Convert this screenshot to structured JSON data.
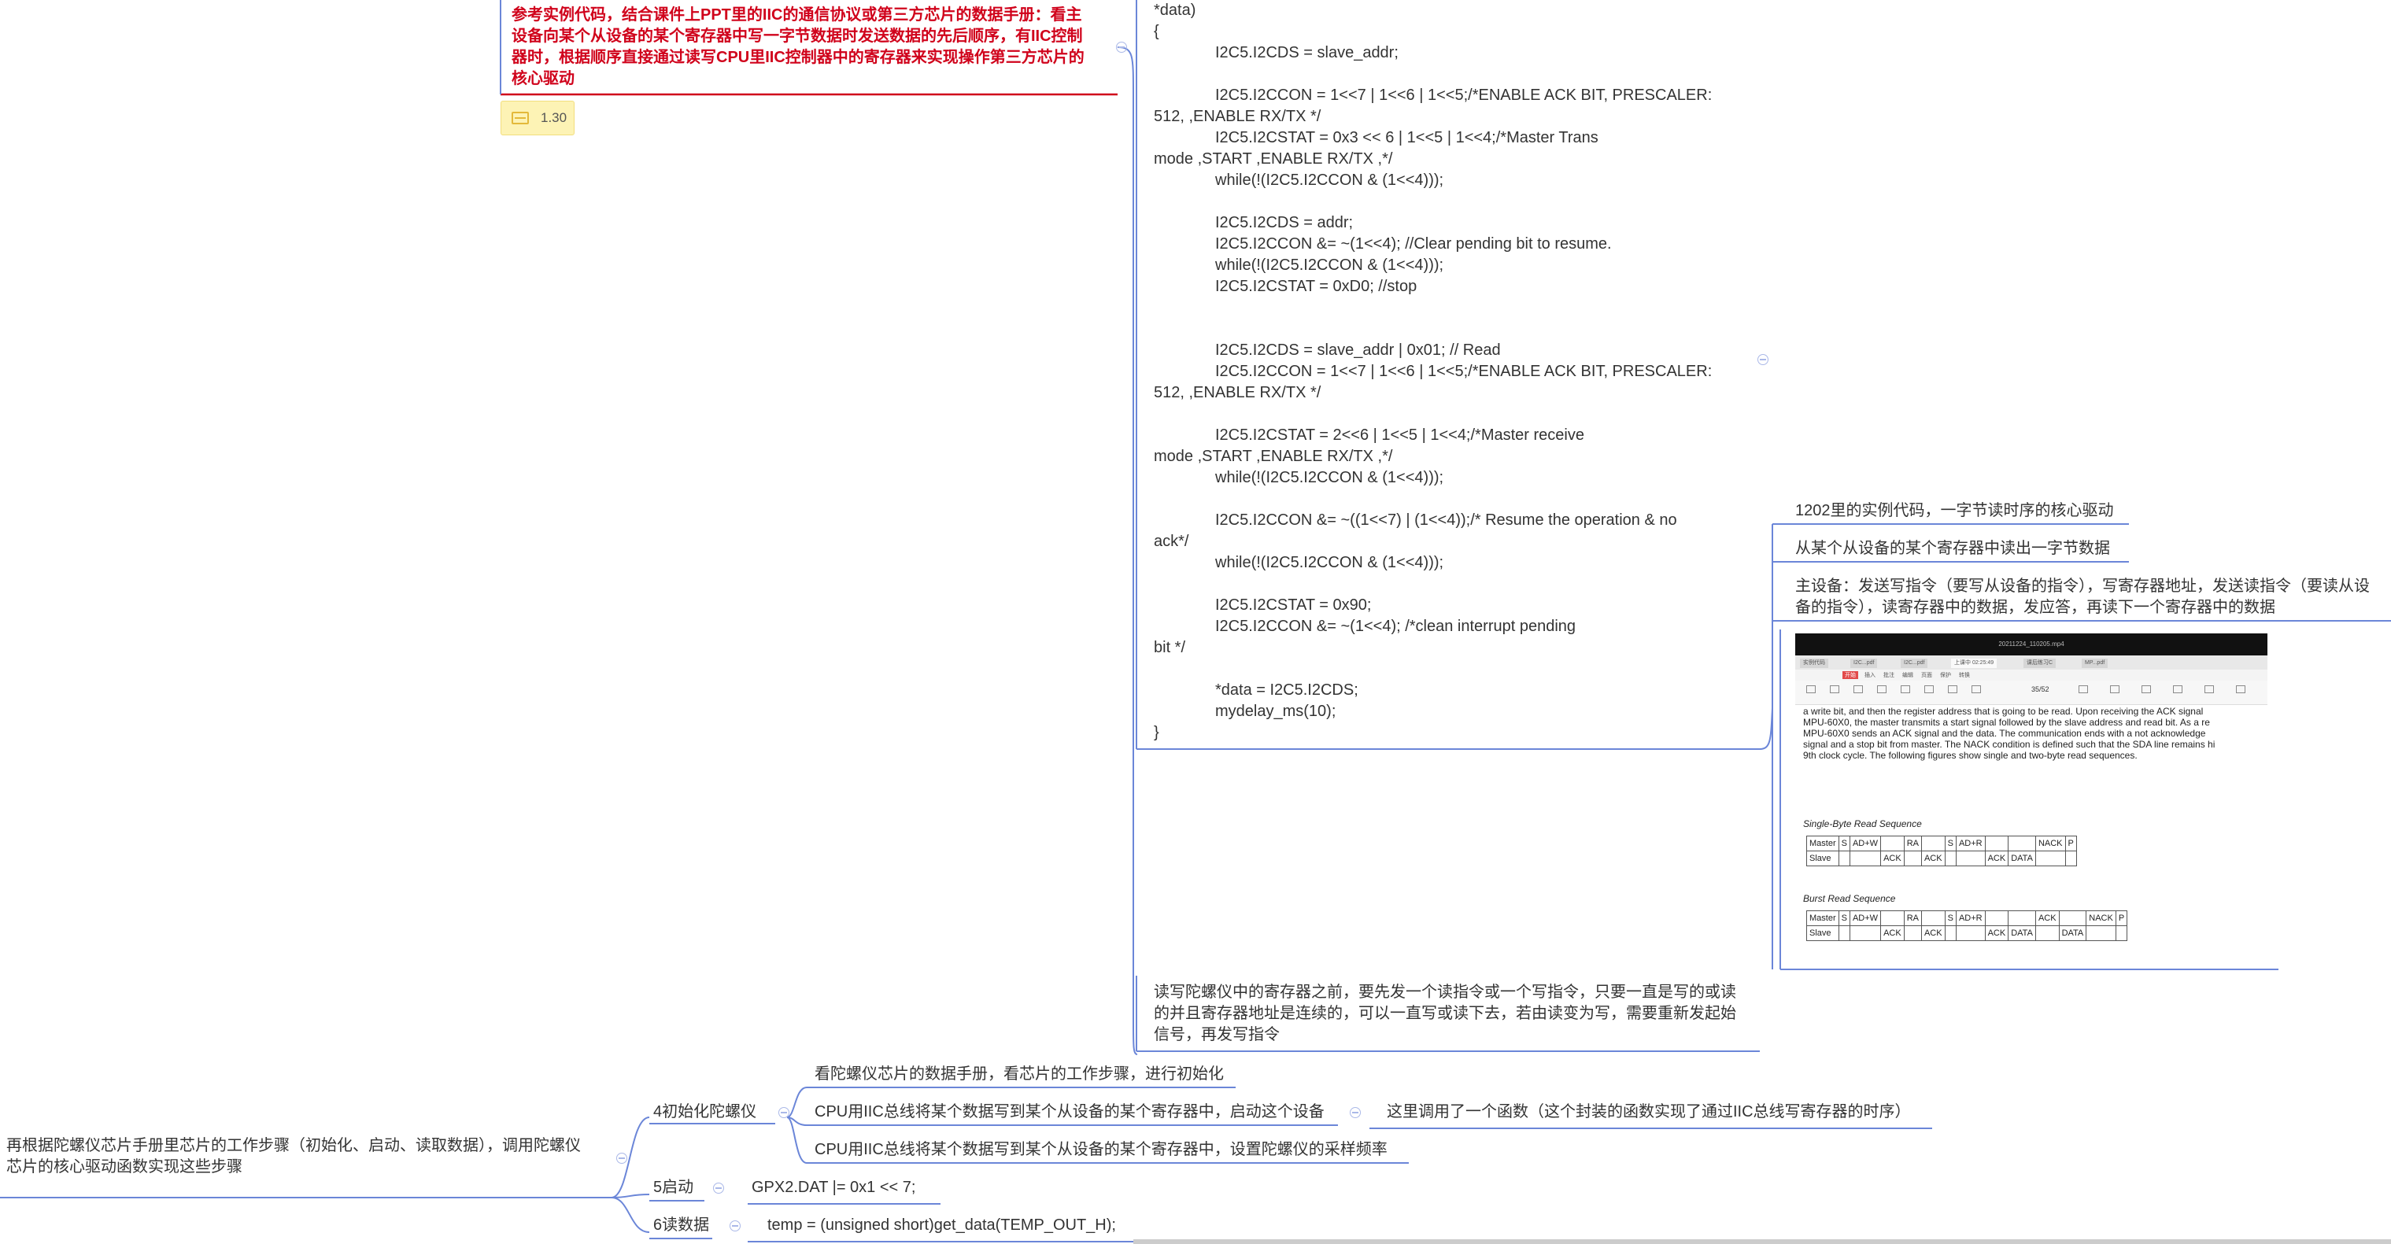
{
  "left_topic": {
    "red_note": [
      "参考实例代码，结合课件上PPT里的IIC的通信协议或第三方芯片的数据手册：看主",
      "设备向某个从设备的某个寄存器中写一字节数据时发送数据的先后顺序，有IIC控制",
      "器时，根据顺序直接通过读写CPU里IIC控制器中的寄存器来实现操作第三方芯片的",
      "核心驱动"
    ],
    "tag_value": "1.30"
  },
  "code": [
    {
      "t": "*data)",
      "i": false
    },
    {
      "t": "{",
      "i": false
    },
    {
      "t": "I2C5.I2CDS = slave_addr;",
      "i": true
    },
    {
      "t": "",
      "i": false
    },
    {
      "t": "I2C5.I2CCON = 1<<7 | 1<<6 | 1<<5;/*ENABLE ACK BIT, PRESCALER:",
      "i": true
    },
    {
      "t": "512, ,ENABLE RX/TX */",
      "i": false
    },
    {
      "t": "I2C5.I2CSTAT = 0x3 << 6 | 1<<5 | 1<<4;/*Master Trans",
      "i": true
    },
    {
      "t": "mode ,START ,ENABLE RX/TX ,*/",
      "i": false
    },
    {
      "t": "while(!(I2C5.I2CCON & (1<<4)));",
      "i": true
    },
    {
      "t": "",
      "i": false
    },
    {
      "t": "I2C5.I2CDS = addr;",
      "i": true
    },
    {
      "t": "I2C5.I2CCON &= ~(1<<4);          //Clear pending bit to resume.",
      "i": true
    },
    {
      "t": "while(!(I2C5.I2CCON & (1<<4)));",
      "i": true
    },
    {
      "t": "I2C5.I2CSTAT = 0xD0; //stop",
      "i": true
    },
    {
      "t": "",
      "i": false
    },
    {
      "t": "",
      "i": false
    },
    {
      "t": "I2C5.I2CDS = slave_addr | 0x01; // Read",
      "i": true
    },
    {
      "t": "I2C5.I2CCON = 1<<7 | 1<<6 | 1<<5;/*ENABLE ACK BIT, PRESCALER:",
      "i": true
    },
    {
      "t": "512, ,ENABLE RX/TX */",
      "i": false
    },
    {
      "t": "",
      "i": false
    },
    {
      "t": "I2C5.I2CSTAT = 2<<6 | 1<<5 | 1<<4;/*Master receive",
      "i": true
    },
    {
      "t": "mode ,START ,ENABLE RX/TX ,*/",
      "i": false
    },
    {
      "t": "while(!(I2C5.I2CCON & (1<<4)));",
      "i": true
    },
    {
      "t": "",
      "i": false
    },
    {
      "t": "I2C5.I2CCON &= ~((1<<7) | (1<<4));/* Resume the operation  & no",
      "i": true
    },
    {
      "t": "ack*/",
      "i": false
    },
    {
      "t": "while(!(I2C5.I2CCON & (1<<4)));",
      "i": true
    },
    {
      "t": "",
      "i": false
    },
    {
      "t": "I2C5.I2CSTAT = 0x90;",
      "i": true
    },
    {
      "t": "I2C5.I2CCON &= ~(1<<4);                        /*clean interrupt pending",
      "i": true
    },
    {
      "t": "bit  */",
      "i": false
    },
    {
      "t": "",
      "i": false
    },
    {
      "t": "*data = I2C5.I2CDS;",
      "i": true
    },
    {
      "t": "mydelay_ms(10);",
      "i": true
    },
    {
      "t": "}",
      "i": false
    }
  ],
  "right_topics": {
    "title": "1202里的实例代码，一字节读时序的核心驱动",
    "read_byte": "从某个从设备的某个寄存器中读出一字节数据",
    "master_steps": [
      "主设备：发送写指令（要写从设备的指令），写寄存器地址，发送读指令（要读从设",
      "备的指令），读寄存器中的数据，发应答，再读下一个寄存器中的数据"
    ]
  },
  "gyro_note": [
    "读写陀螺仪中的寄存器之前，要先发一个读指令或一个写指令，只要一直是写的或读",
    "的并且寄存器地址是连续的，可以一直写或读下去，若由读变为写，需要重新发起始",
    "信号，再发写指令"
  ],
  "root_topic": [
    "再根据陀螺仪芯片手册里芯片的工作步骤（初始化、启动、读取数据），调用陀螺仪",
    "芯片的核心驱动函数实现这些步骤"
  ],
  "steps": {
    "init": {
      "label": "4初始化陀螺仪",
      "children": [
        "看陀螺仪芯片的数据手册，看芯片的工作步骤，进行初始化",
        "CPU用IIC总线将某个数据写到某个从设备的某个寄存器中，启动这个设备",
        "CPU用IIC总线将某个数据写到某个从设备的某个寄存器中，设置陀螺仪的采样频率"
      ],
      "note": "这里调用了一个函数（这个封装的函数实现了通过IIC总线写寄存器的时序）"
    },
    "start": {
      "label": "5启动",
      "code": "GPX2.DAT |= 0x1 << 7;"
    },
    "read": {
      "label": "6读数据",
      "code": "temp = (unsigned short)get_data(TEMP_OUT_H);"
    }
  },
  "screenshot": {
    "title": "20211224_110205.mp4",
    "tabs": [
      "实例代码",
      "I2C...pdf",
      "I2C...pdf",
      "上课中 02:25:49",
      "课后练习C",
      "MP...pdf"
    ],
    "menu": [
      "开始",
      "插入",
      "批注",
      "编辑",
      "页面",
      "保护",
      "转换"
    ],
    "page_indicator": "35/52",
    "paragraph": [
      "a write bit, and then the register address that is going to be read. Upon receiving the ACK signal",
      "MPU-60X0, the master transmits a start signal followed by the slave address and read bit. As a re",
      "MPU-60X0 sends an ACK signal and the data. The communication ends with a not acknowledge",
      "signal and a stop bit from master. The NACK condition is defined such that the SDA line remains hi",
      "9th clock cycle. The following figures show single and two-byte read sequences."
    ],
    "single_caption": "Single-Byte Read Sequence",
    "burst_caption": "Burst Read Sequence",
    "single_master": [
      "Master",
      "S",
      "AD+W",
      "",
      "RA",
      "",
      "S",
      "AD+R",
      "",
      "",
      "NACK",
      "P"
    ],
    "single_slave": [
      "Slave",
      "",
      "",
      "ACK",
      "",
      "ACK",
      "",
      "",
      "ACK",
      "DATA",
      "",
      ""
    ],
    "burst_master": [
      "Master",
      "S",
      "AD+W",
      "",
      "RA",
      "",
      "S",
      "AD+R",
      "",
      "",
      "ACK",
      "",
      "NACK",
      "P"
    ],
    "burst_slave": [
      "Slave",
      "",
      "",
      "ACK",
      "",
      "ACK",
      "",
      "",
      "ACK",
      "DATA",
      "",
      "DATA",
      "",
      ""
    ]
  },
  "colors": {
    "line": "#6b86d8",
    "red": "#d0021b",
    "indicator": "#aab8e8",
    "tag_bg": "#fdf3b5"
  }
}
